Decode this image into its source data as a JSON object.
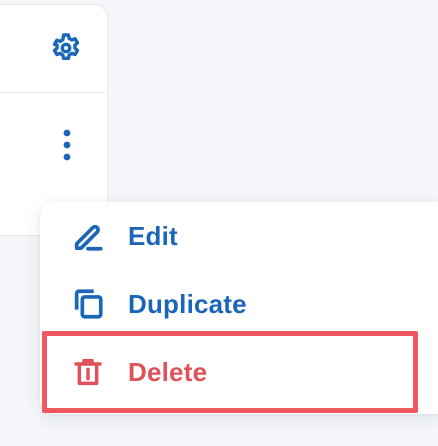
{
  "toolbar": {
    "settings_icon": "gear-icon",
    "more_icon": "vertical-ellipsis-icon"
  },
  "menu": {
    "items": [
      {
        "label": "Edit",
        "icon": "pencil-icon"
      },
      {
        "label": "Duplicate",
        "icon": "copy-icon"
      },
      {
        "label": "Delete",
        "icon": "trash-icon"
      }
    ]
  },
  "colors": {
    "accent": "#1a66b8",
    "danger": "#e0525b",
    "highlight": "#f0575e",
    "background": "#f4f6f9"
  }
}
